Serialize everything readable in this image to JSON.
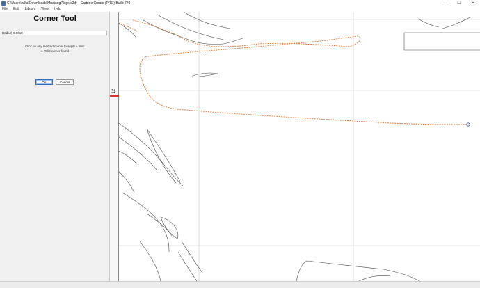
{
  "window": {
    "title": "C:\\Users\\willa\\Downloads\\MustangPlugs.c2d* - Carbide Create (PRO) Build 770",
    "controls": {
      "minimize": "—",
      "maximize": "☐",
      "close": "✕"
    }
  },
  "menu": {
    "items": [
      {
        "label": "File"
      },
      {
        "label": "Edit"
      },
      {
        "label": "Library"
      },
      {
        "label": "View"
      },
      {
        "label": "Help"
      }
    ]
  },
  "panel": {
    "title": "Corner Tool",
    "radius_label": "Radius",
    "radius_value": "0.0010",
    "instruction": "Click on any marked corner to apply a fillet.",
    "status": "1 Valid corner found",
    "ok_label": "OK",
    "cancel_label": "Cancel"
  },
  "ruler": {
    "label": "12"
  },
  "colors": {
    "selection": "#e8732a",
    "geometry": "#4a4a4a",
    "grid": "#c9c9d6",
    "ruler_marker": "#d9342b"
  }
}
